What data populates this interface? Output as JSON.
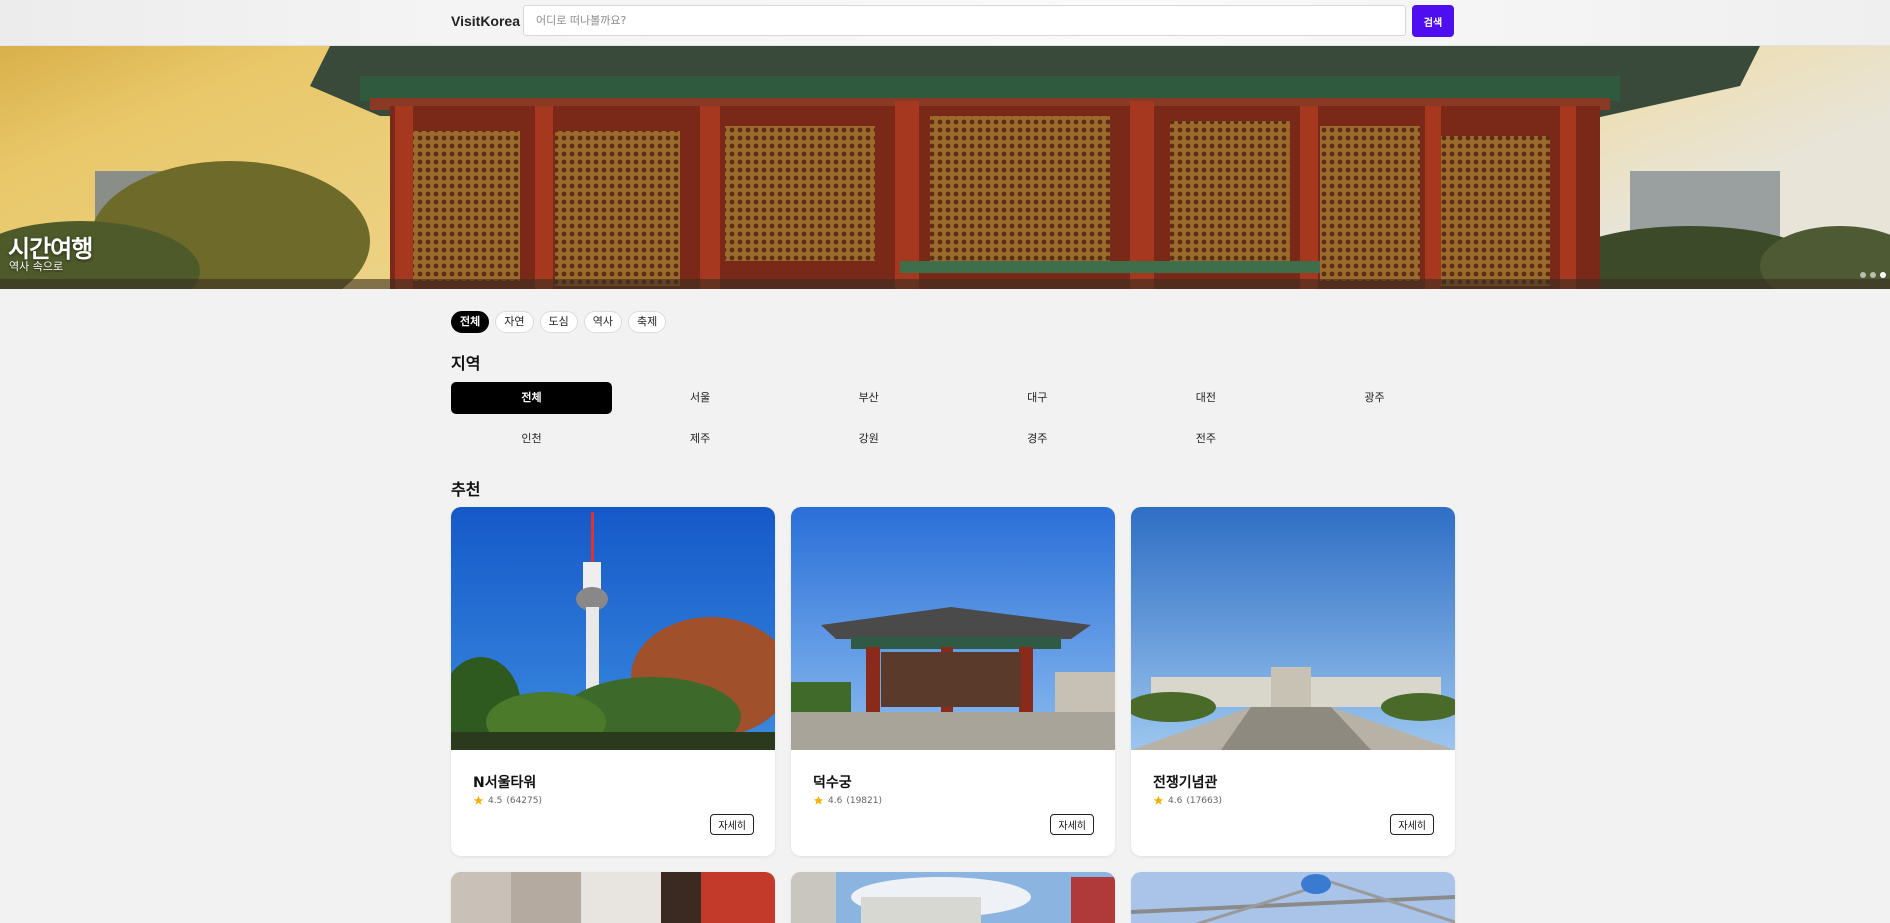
{
  "header": {
    "brand": "VisitKorea",
    "search_placeholder": "어디로 떠나볼까요?",
    "search_button": "검색"
  },
  "hero": {
    "title": "시간여행",
    "subtitle": "역사 속으로",
    "slide_count": 3,
    "active_slide": 3
  },
  "categories": [
    "전체",
    "자연",
    "도심",
    "역사",
    "축제"
  ],
  "active_category": "전체",
  "region_section": {
    "title": "지역",
    "items": [
      "전체",
      "서울",
      "부산",
      "대구",
      "대전",
      "광주",
      "인천",
      "제주",
      "강원",
      "경주",
      "전주"
    ],
    "active": "전체"
  },
  "recommend_section": {
    "title": "추천",
    "cards": [
      {
        "name": "N서울타워",
        "rating": "4.5",
        "reviews": "(64275)",
        "button": "자세히",
        "icon": "star-icon"
      },
      {
        "name": "덕수궁",
        "rating": "4.6",
        "reviews": "(19821)",
        "button": "자세히",
        "icon": "star-icon"
      },
      {
        "name": "전쟁기념관",
        "rating": "4.6",
        "reviews": "(17663)",
        "button": "자세히",
        "icon": "star-icon"
      }
    ]
  },
  "colors": {
    "accent": "#4d0ff0",
    "active_chip": "#000000",
    "star": "#f5b300"
  }
}
